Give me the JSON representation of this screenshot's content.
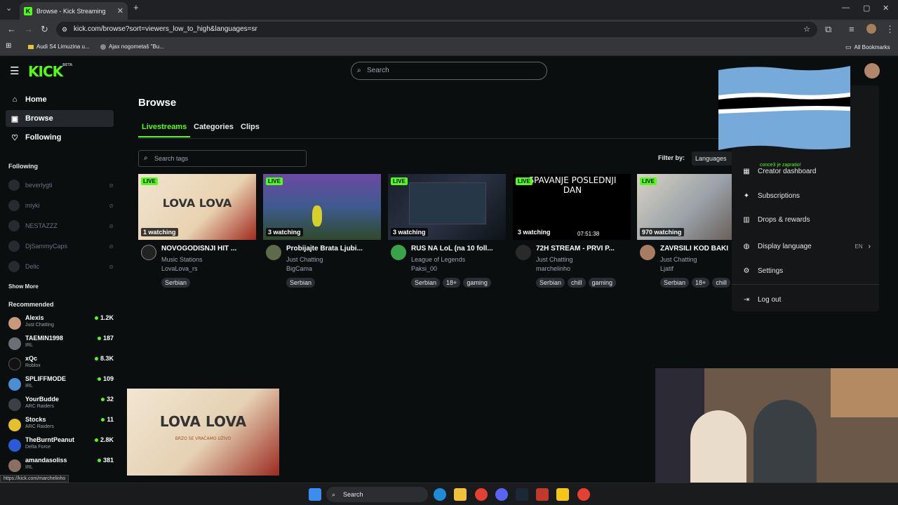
{
  "browser": {
    "tab_title": "Browse - Kick Streaming",
    "tab_icon": "K",
    "url": "kick.com/browse?sort=viewers_low_to_high&languages=sr",
    "bookmarks": [
      "Audi S4 Limuzina u...",
      "Ajax nogometaš \"Bu..."
    ],
    "all_bookmarks": "All Bookmarks"
  },
  "header": {
    "logo": "KICK",
    "logo_badge": "BETA",
    "search_placeholder": "Search"
  },
  "sidebar": {
    "nav": [
      {
        "label": "Home",
        "icon": "home-icon"
      },
      {
        "label": "Browse",
        "icon": "browse-icon"
      },
      {
        "label": "Following",
        "icon": "heart-icon"
      }
    ],
    "following_title": "Following",
    "following": [
      "beverlygti",
      "miyki",
      "NESTAZZZ",
      "DjSammyCaps",
      "Delic"
    ],
    "show_more": "Show More",
    "recommended_title": "Recommended",
    "recommended": [
      {
        "name": "Alexis",
        "category": "Just Chatting",
        "viewers": "1.2K"
      },
      {
        "name": "TAEMIN1998",
        "category": "IRL",
        "viewers": "187"
      },
      {
        "name": "xQc",
        "category": "Roblox",
        "viewers": "8.3K"
      },
      {
        "name": "SPLIFFMODE",
        "category": "IRL",
        "viewers": "109"
      },
      {
        "name": "YourBudde",
        "category": "ARC Raiders",
        "viewers": "32"
      },
      {
        "name": "Stocks",
        "category": "ARC Raiders",
        "viewers": "11"
      },
      {
        "name": "TheBurntPeanut",
        "category": "Delta Force",
        "viewers": "2.8K"
      },
      {
        "name": "amandasoliss",
        "category": "IRL",
        "viewers": "381"
      }
    ]
  },
  "main": {
    "title": "Browse",
    "tabs": [
      "Livestreams",
      "Categories",
      "Clips"
    ],
    "tag_search_placeholder": "Search tags",
    "filter_label": "Filter by:",
    "filter_value": "Languages",
    "live_badge": "LIVE",
    "cards": [
      {
        "watching": "1 watching",
        "title": "NOVOGODIŠNJI HIT ...",
        "category": "Music Stations",
        "user": "LovaLova_rs",
        "tags": [
          "Serbian"
        ],
        "thumb_text": "LOVA LOVA"
      },
      {
        "watching": "3 watching",
        "title": "Probijajte Brata Ljubi...",
        "category": "Just Chatting",
        "user": "BigCama",
        "tags": [
          "Serbian"
        ],
        "thumb_text": ""
      },
      {
        "watching": "3 watching",
        "title": "RUS NA LoL (na 10 foll...",
        "category": "League of Legends",
        "user": "Paksi_00",
        "tags": [
          "Serbian",
          "18+",
          "gaming"
        ],
        "thumb_text": ""
      },
      {
        "watching": "3 watching",
        "title": "72H STREAM - PRVI P...",
        "category": "Just Chatting",
        "user": "marchelinho",
        "tags": [
          "Serbian",
          "chill",
          "gaming"
        ],
        "thumb_text": "SPAVANJE POSLEDNJI DAN",
        "duration": "07:51:38"
      },
      {
        "watching": "970 watching",
        "title": "ZAVRSILI KOD BAKI",
        "category": "Just Chatting",
        "user": "Ljatif",
        "tags": [
          "Serbian",
          "18+",
          "chill"
        ],
        "thumb_text": ""
      }
    ],
    "preview_text": "LOVA LOVA",
    "preview_sub": "BRZO SE VRAĆAMO UŽIVO"
  },
  "dropdown": {
    "notice": "conce3 je zapratio!",
    "items": [
      {
        "label": "Creator dashboard",
        "icon": "dashboard-icon"
      },
      {
        "label": "Subscriptions",
        "icon": "subscriptions-icon"
      },
      {
        "label": "Drops & rewards",
        "icon": "drops-icon"
      },
      {
        "label": "Display language",
        "icon": "globe-icon",
        "value": "EN"
      },
      {
        "label": "Settings",
        "icon": "gear-icon"
      },
      {
        "label": "Log out",
        "icon": "logout-icon"
      }
    ]
  },
  "status_url": "https://kick.com/marchelinho",
  "taskbar": {
    "search": "Search"
  },
  "colors": {
    "accent": "#53fc18",
    "bg": "#0b0e0f",
    "panel": "#141618"
  }
}
